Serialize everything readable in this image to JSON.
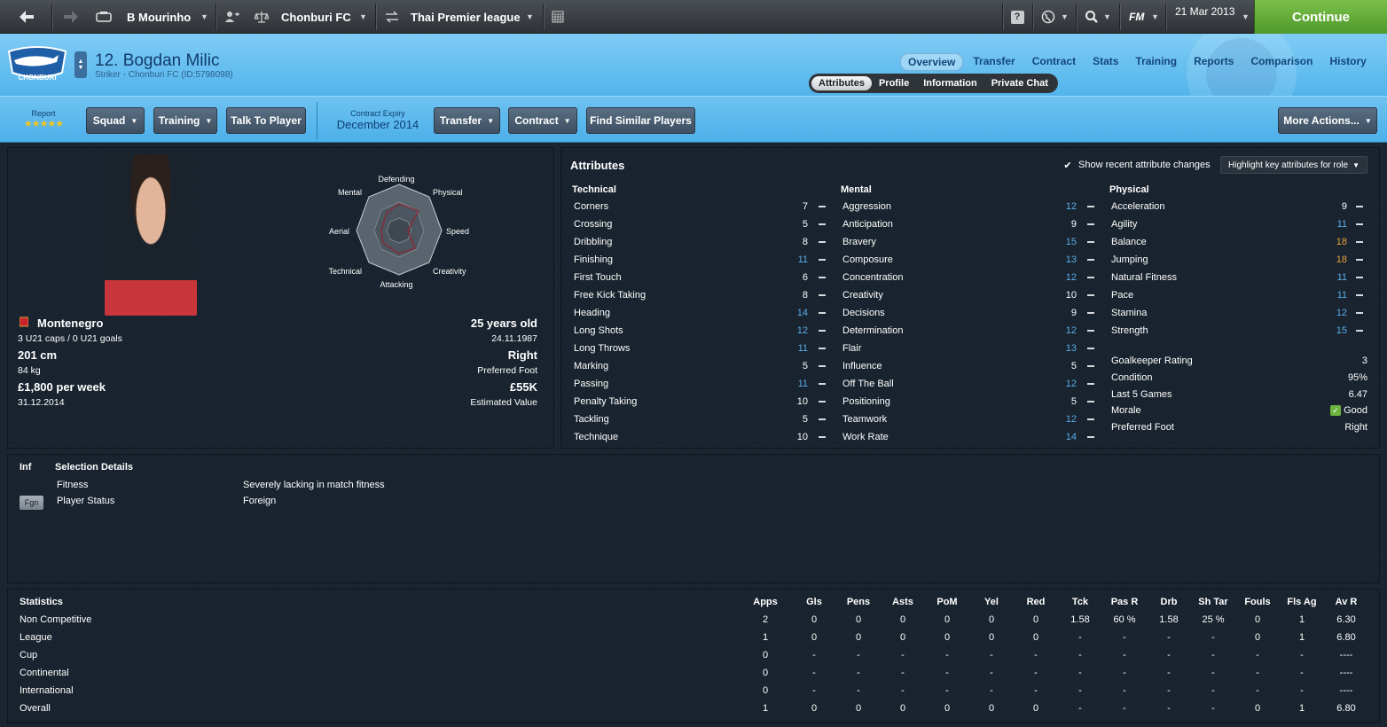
{
  "topbar": {
    "manager": "B Mourinho",
    "club": "Chonburi FC",
    "league": "Thai Premier league",
    "date": "21 Mar 2013",
    "continue_label": "Continue",
    "fm_label": "FM"
  },
  "header": {
    "player_title": "12. Bogdan Milic",
    "player_sub": "Striker - Chonburi FC (ID:5798098)",
    "club_logo_text": "CHONBURI",
    "tabs": [
      "Overview",
      "Transfer",
      "Contract",
      "Stats",
      "Training",
      "Reports",
      "Comparison",
      "History"
    ],
    "subtabs": [
      "Attributes",
      "Profile",
      "Information",
      "Private Chat"
    ]
  },
  "actions": {
    "report_label": "Report",
    "stars": "★★★★★",
    "squad": "Squad",
    "training": "Training",
    "talk": "Talk To Player",
    "contract_expiry_label": "Contract Expiry",
    "contract_expiry": "December 2014",
    "transfer": "Transfer",
    "contract": "Contract",
    "find_similar": "Find Similar Players",
    "more_actions": "More Actions..."
  },
  "bio": {
    "nation": "Montenegro",
    "caps": "3 U21 caps / 0 U21 goals",
    "height": "201 cm",
    "weight": "84 kg",
    "wage": "£1,800 per week",
    "contract_end": "31.12.2014",
    "age": "25 years old",
    "dob": "24.11.1987",
    "foot": "Right",
    "foot_label": "Preferred Foot",
    "value": "£55K",
    "value_label": "Estimated Value"
  },
  "radar": {
    "labels": [
      "Defending",
      "Physical",
      "Speed",
      "Creativity",
      "Attacking",
      "Technical",
      "Aerial",
      "Mental"
    ]
  },
  "attributes": {
    "title": "Attributes",
    "show_changes": "Show recent attribute changes",
    "highlight": "Highlight key attributes for role",
    "technical_title": "Technical",
    "mental_title": "Mental",
    "physical_title": "Physical",
    "technical": [
      {
        "name": "Corners",
        "value": "7",
        "color": "w"
      },
      {
        "name": "Crossing",
        "value": "5",
        "color": "w"
      },
      {
        "name": "Dribbling",
        "value": "8",
        "color": "w"
      },
      {
        "name": "Finishing",
        "value": "11",
        "color": "b"
      },
      {
        "name": "First Touch",
        "value": "6",
        "color": "w"
      },
      {
        "name": "Free Kick Taking",
        "value": "8",
        "color": "w"
      },
      {
        "name": "Heading",
        "value": "14",
        "color": "b"
      },
      {
        "name": "Long Shots",
        "value": "12",
        "color": "b"
      },
      {
        "name": "Long Throws",
        "value": "11",
        "color": "b"
      },
      {
        "name": "Marking",
        "value": "5",
        "color": "w"
      },
      {
        "name": "Passing",
        "value": "11",
        "color": "b"
      },
      {
        "name": "Penalty Taking",
        "value": "10",
        "color": "w"
      },
      {
        "name": "Tackling",
        "value": "5",
        "color": "w"
      },
      {
        "name": "Technique",
        "value": "10",
        "color": "w"
      }
    ],
    "mental": [
      {
        "name": "Aggression",
        "value": "12",
        "color": "b"
      },
      {
        "name": "Anticipation",
        "value": "9",
        "color": "w"
      },
      {
        "name": "Bravery",
        "value": "15",
        "color": "b"
      },
      {
        "name": "Composure",
        "value": "13",
        "color": "b"
      },
      {
        "name": "Concentration",
        "value": "12",
        "color": "b"
      },
      {
        "name": "Creativity",
        "value": "10",
        "color": "w"
      },
      {
        "name": "Decisions",
        "value": "9",
        "color": "w"
      },
      {
        "name": "Determination",
        "value": "12",
        "color": "b"
      },
      {
        "name": "Flair",
        "value": "13",
        "color": "b"
      },
      {
        "name": "Influence",
        "value": "5",
        "color": "w"
      },
      {
        "name": "Off The Ball",
        "value": "12",
        "color": "b"
      },
      {
        "name": "Positioning",
        "value": "5",
        "color": "w"
      },
      {
        "name": "Teamwork",
        "value": "12",
        "color": "b"
      },
      {
        "name": "Work Rate",
        "value": "14",
        "color": "b"
      }
    ],
    "physical": [
      {
        "name": "Acceleration",
        "value": "9",
        "color": "w"
      },
      {
        "name": "Agility",
        "value": "11",
        "color": "b"
      },
      {
        "name": "Balance",
        "value": "18",
        "color": "o"
      },
      {
        "name": "Jumping",
        "value": "18",
        "color": "o"
      },
      {
        "name": "Natural Fitness",
        "value": "11",
        "color": "b"
      },
      {
        "name": "Pace",
        "value": "11",
        "color": "b"
      },
      {
        "name": "Stamina",
        "value": "12",
        "color": "b"
      },
      {
        "name": "Strength",
        "value": "15",
        "color": "b"
      }
    ],
    "extra": [
      {
        "name": "Goalkeeper Rating",
        "value": "3"
      },
      {
        "name": "Condition",
        "value": "95%"
      },
      {
        "name": "Last 5 Games",
        "value": "6.47"
      },
      {
        "name": "Morale",
        "value": "Good"
      },
      {
        "name": "Preferred Foot",
        "value": "Right"
      }
    ]
  },
  "selection": {
    "inf_label": "Inf",
    "title": "Selection Details",
    "fgn_badge": "Fgn",
    "rows": [
      {
        "label": "Fitness",
        "value": "Severely lacking in match fitness"
      },
      {
        "label": "Player Status",
        "value": "Foreign"
      }
    ]
  },
  "statistics": {
    "title": "Statistics",
    "columns": [
      "Apps",
      "Gls",
      "Pens",
      "Asts",
      "PoM",
      "Yel",
      "Red",
      "Tck",
      "Pas R",
      "Drb",
      "Sh Tar",
      "Fouls",
      "Fls Ag",
      "Av R"
    ],
    "rows": [
      {
        "label": "Non Competitive",
        "cells": [
          "2",
          "0",
          "0",
          "0",
          "0",
          "0",
          "0",
          "1.58",
          "60 %",
          "1.58",
          "25 %",
          "0",
          "1",
          "6.30"
        ]
      },
      {
        "label": "League",
        "cells": [
          "1",
          "0",
          "0",
          "0",
          "0",
          "0",
          "0",
          "-",
          "-",
          "-",
          "-",
          "0",
          "1",
          "6.80"
        ]
      },
      {
        "label": "Cup",
        "cells": [
          "0",
          "-",
          "-",
          "-",
          "-",
          "-",
          "-",
          "-",
          "-",
          "-",
          "-",
          "-",
          "-",
          "----"
        ]
      },
      {
        "label": "Continental",
        "cells": [
          "0",
          "-",
          "-",
          "-",
          "-",
          "-",
          "-",
          "-",
          "-",
          "-",
          "-",
          "-",
          "-",
          "----"
        ]
      },
      {
        "label": "International",
        "cells": [
          "0",
          "-",
          "-",
          "-",
          "-",
          "-",
          "-",
          "-",
          "-",
          "-",
          "-",
          "-",
          "-",
          "----"
        ]
      },
      {
        "label": "Overall",
        "cells": [
          "1",
          "0",
          "0",
          "0",
          "0",
          "0",
          "0",
          "-",
          "-",
          "-",
          "-",
          "0",
          "1",
          "6.80"
        ]
      }
    ]
  },
  "colors": {
    "accent": "#52b4ec",
    "continue": "#5fa836",
    "attr_blue": "#5aaee8",
    "attr_orange": "#e8a13b"
  }
}
